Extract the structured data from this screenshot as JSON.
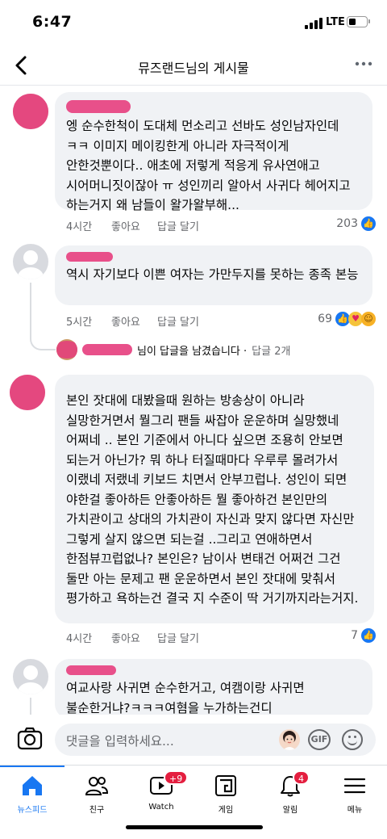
{
  "status_bar": {
    "time": "6:47",
    "network": "LTE"
  },
  "header": {
    "title": "뮤즈랜드님의 게시물"
  },
  "comments": [
    {
      "text": "엥 순수한척이 도대체 먼소리고 선바도 성인남자인데 ㅋㅋ 이미지 메이킹한게 아니라 자극적이게 안한것뿐이다.. 애초에 저렇게 적응게 유사연애고 시어머니짓이잖아 ㅠ 성인끼리 알아서 사귀다 헤어지고 하는거지 왜 남들이 왈가왈부해...",
      "time": "4시간",
      "like": "좋아요",
      "reply": "답글 달기",
      "reaction_count": "203"
    },
    {
      "text": "역시 자기보다 이쁜 여자는 가만두지를 못하는 종족 본능",
      "time": "5시간",
      "like": "좋아요",
      "reply": "답글 달기",
      "reaction_count": "69",
      "reply_summary": {
        "text": "님이 답글을 남겼습니다 ·",
        "count": "답글 2개"
      }
    },
    {
      "text": "본인 잣대에 대봤을때 원하는 방송상이 아니라 실망한거면서 뭘그리 팬들 싸잡아 운운하며 실망했네 어쩌네 .. 본인 기준에서 아니다 싶으면 조용히 안보면 되는거 아닌가? 뭐 하나 터질때마다 우루루 몰려가서 이랬네 저랬네 키보드 치면서 안부끄럽나. 성인이 되면 야한걸 좋아하든 안좋아하든 뭘 좋아하건 본인만의 가치관이고 상대의 가치관이 자신과 맞지 않다면 자신만 그렇게 살지 않으면 되는걸 ..그리고 연애하면서 한점뷰끄럽없나? 본인은? 남이사 변태건 어쩌건 그건 둘만 아는 문제고 팬 운운하면서 본인 잣대에 맞춰서 평가하고 욕하는건 결국 지 수준이 딱 거기까지라는거지.",
      "time": "4시간",
      "like": "좋아요",
      "reply": "답글 달기",
      "reaction_count": "7"
    },
    {
      "text": "여교사랑 사귀면 순수한거고, 여캠이랑 사귀면 불순한거냐?ㅋㅋㅋ여혐을 누가하는건디"
    }
  ],
  "comment_input": {
    "placeholder": "댓글을 입력하세요...",
    "gif": "GIF"
  },
  "tabs": [
    {
      "label": "뉴스피드",
      "icon": "home-icon"
    },
    {
      "label": "친구",
      "icon": "friends-icon"
    },
    {
      "label": "Watch",
      "icon": "watch-icon",
      "badge": "+9"
    },
    {
      "label": "게임",
      "icon": "gaming-icon"
    },
    {
      "label": "알림",
      "icon": "bell-icon",
      "badge": "4"
    },
    {
      "label": "메뉴",
      "icon": "menu-icon"
    }
  ],
  "colors": {
    "accent": "#1877f2",
    "badge": "#e41e3f",
    "bubble": "#f0f2f5",
    "redaction": "#e8508a"
  }
}
